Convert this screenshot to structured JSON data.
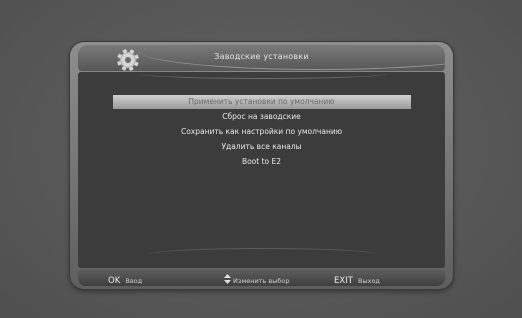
{
  "dialog": {
    "title": "Заводские установки",
    "icon": "gear-icon"
  },
  "menu": {
    "items": [
      {
        "label": "Применить установки по умолчанию",
        "selected": true
      },
      {
        "label": "Сброс на заводские",
        "selected": false
      },
      {
        "label": "Сохранить как настройки по умолчанию",
        "selected": false
      },
      {
        "label": "Удалить все каналы",
        "selected": false
      },
      {
        "label": "Boot to E2",
        "selected": false
      }
    ]
  },
  "footer": {
    "ok_key": "OK",
    "ok_label": "Ввод",
    "change_icon": "up-down-arrows-icon",
    "change_label": "Изменить выбор",
    "exit_key": "EXIT",
    "exit_label": "Выход"
  },
  "colors": {
    "background": "#5a5a5a",
    "panel": "#3c3c3c",
    "highlight": "#b8b8b8",
    "text": "#e9e9e9"
  }
}
